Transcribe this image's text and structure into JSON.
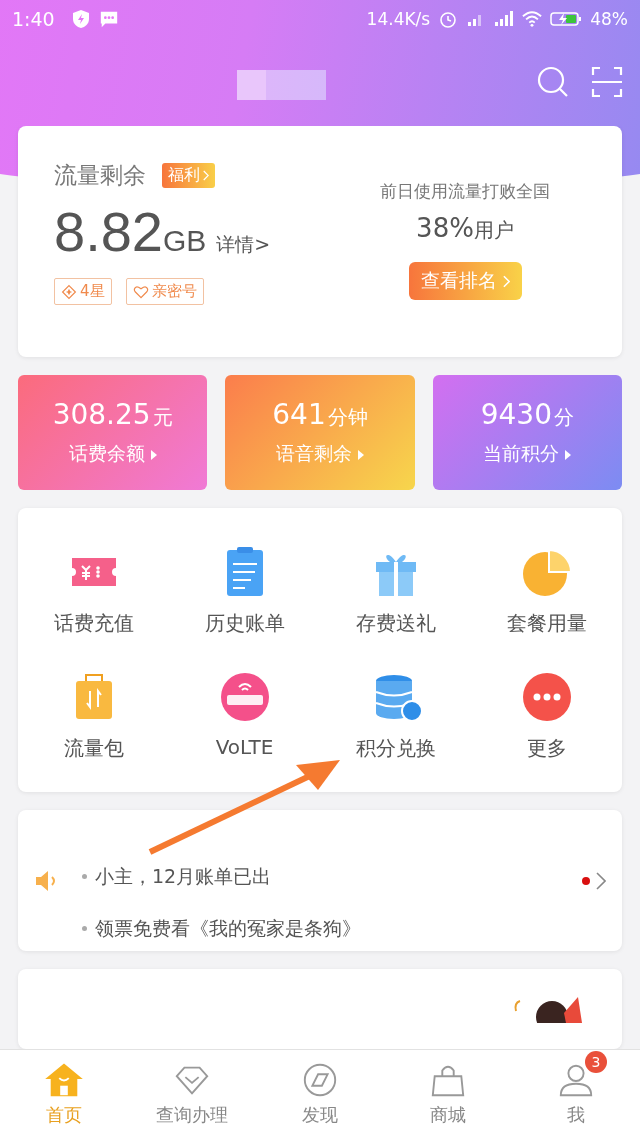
{
  "status_bar": {
    "time": "1:40",
    "speed": "14.4K/s",
    "battery": "48%"
  },
  "data_card": {
    "title": "流量剩余",
    "badge": "福利",
    "amount": "8.82",
    "unit": "GB",
    "detail": "详情>",
    "tags": [
      {
        "kind": "star",
        "label": "4星"
      },
      {
        "kind": "heart",
        "label": "亲密号"
      }
    ],
    "rank_caption": "前日使用流量打败全国",
    "rank_value": "38%",
    "rank_unit": "用户",
    "rank_button": "查看排名"
  },
  "stats": [
    {
      "kind": "fee",
      "value": "308.25",
      "unit": "元",
      "label": "话费余额"
    },
    {
      "kind": "voice",
      "value": "641",
      "unit": "分钟",
      "label": "语音剩余"
    },
    {
      "kind": "points",
      "value": "9430",
      "unit": "分",
      "label": "当前积分"
    }
  ],
  "services": [
    {
      "kind": "ticket",
      "label": "话费充值"
    },
    {
      "kind": "clipboard",
      "label": "历史账单"
    },
    {
      "kind": "gift",
      "label": "存费送礼"
    },
    {
      "kind": "pie",
      "label": "套餐用量"
    },
    {
      "kind": "luggage",
      "label": "流量包"
    },
    {
      "kind": "volte",
      "label": "VoLTE"
    },
    {
      "kind": "database",
      "label": "积分兑换"
    },
    {
      "kind": "more",
      "label": "更多"
    }
  ],
  "notices": {
    "unread": true,
    "items": [
      "小主，12月账单已出",
      "领票免费看《我的冤家是条狗》"
    ]
  },
  "tabs": [
    {
      "kind": "home",
      "label": "首页",
      "selected": true
    },
    {
      "kind": "diamond",
      "label": "查询办理",
      "selected": false
    },
    {
      "kind": "compass",
      "label": "发现",
      "selected": false
    },
    {
      "kind": "bag",
      "label": "商城",
      "selected": false
    },
    {
      "kind": "person",
      "label": "我",
      "selected": false,
      "badge": "3"
    }
  ]
}
